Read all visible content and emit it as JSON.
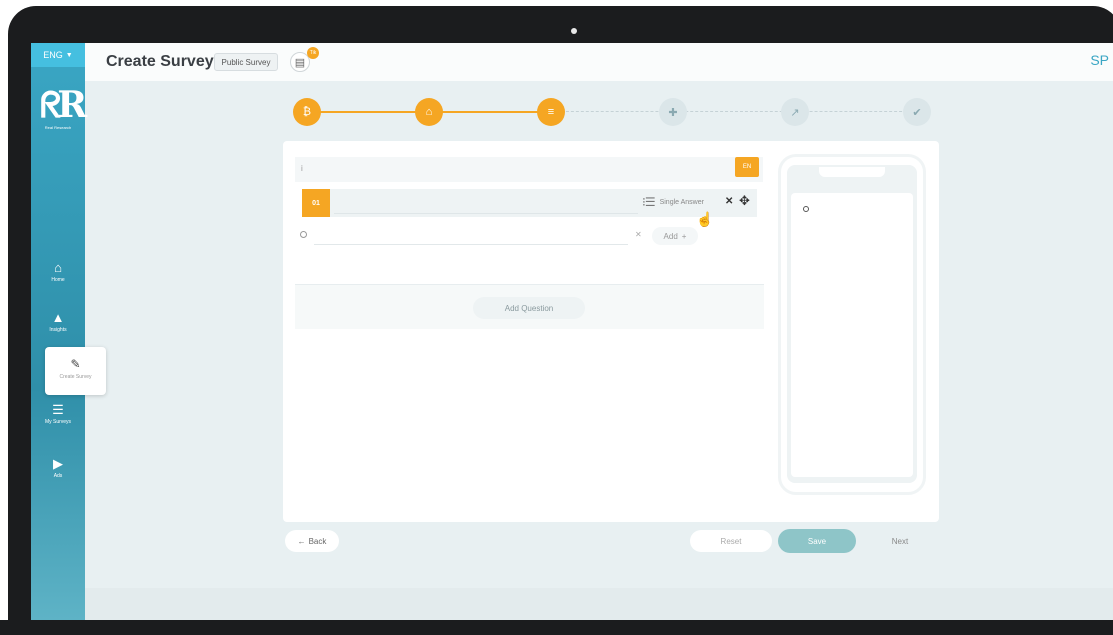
{
  "sidebar": {
    "language": "ENG",
    "logo_text": "Real Research",
    "items": [
      {
        "label": "Home",
        "icon": "home-icon"
      },
      {
        "label": "Insights",
        "icon": "chart-icon"
      },
      {
        "label": "Create Survey",
        "icon": "pencil-icon"
      },
      {
        "label": "My Surveys",
        "icon": "list-icon"
      },
      {
        "label": "Ads",
        "icon": "play-icon"
      }
    ],
    "colors": {
      "bg": "#3aa6c4",
      "lang_bg": "#45bfe0"
    }
  },
  "header": {
    "title": "Create Survey",
    "survey_type": "Public Survey",
    "doc_badge": "Tik",
    "avatar": "SP"
  },
  "stepper": {
    "steps": [
      {
        "icon": "coin-icon",
        "state": "done"
      },
      {
        "icon": "bank-icon",
        "state": "done"
      },
      {
        "icon": "list-icon",
        "state": "current"
      },
      {
        "icon": "puzzle-icon",
        "state": "todo"
      },
      {
        "icon": "trend-icon",
        "state": "todo"
      },
      {
        "icon": "check-icon",
        "state": "todo"
      }
    ],
    "accent": "#f5a623"
  },
  "editor": {
    "info_mark": "i",
    "lang_tag": "EN",
    "question": {
      "number": "01",
      "text": "",
      "type_label": "Single Answer"
    },
    "option": {
      "value": "",
      "add_label": "Add"
    },
    "add_question_label": "Add Question"
  },
  "footer": {
    "back_label": "Back",
    "reset_label": "Reset",
    "save_label": "Save",
    "next_label": "Next"
  }
}
